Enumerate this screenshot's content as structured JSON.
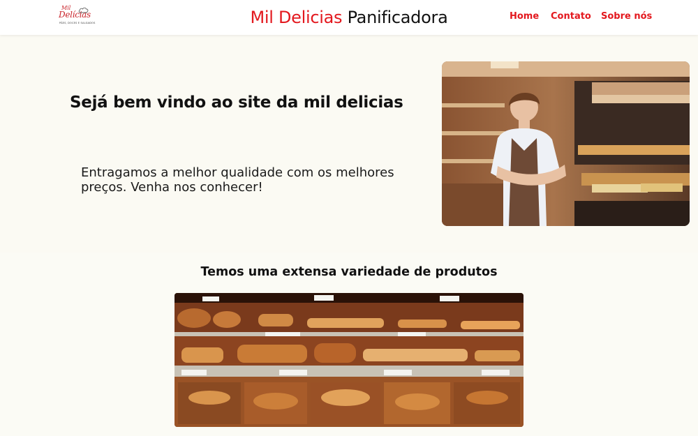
{
  "header": {
    "logo": {
      "line1": "Mil",
      "line2": "Delícias",
      "tagline": "PÃES, DOCES E SALGADOS"
    },
    "brand_red": "Mil Delicias",
    "brand_dark": "Panificadora",
    "nav": [
      "Home",
      "Contato",
      "Sobre nós"
    ]
  },
  "hero": {
    "title": "Sejá bem vindo ao site da mil delicias",
    "text": "Entragamos a melhor qualidade com os melhores preços. Venha nos conhecer!"
  },
  "products": {
    "title": "Temos uma extensa variedade de produtos"
  },
  "colors": {
    "accent": "#e3181e",
    "background": "#fbfaf3",
    "header_bg": "#ffffff"
  }
}
